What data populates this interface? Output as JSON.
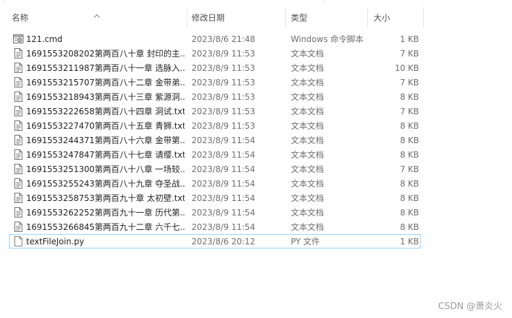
{
  "columns": {
    "name": "名称",
    "date": "修改日期",
    "type": "类型",
    "size": "大小"
  },
  "sort": {
    "column": "name",
    "icon": "chevron-up-icon"
  },
  "files": [
    {
      "name": "121.cmd",
      "date": "2023/8/6 21:48",
      "type": "Windows 命令脚本",
      "size": "1 KB",
      "icon": "cmd-file-icon"
    },
    {
      "name": "1691553208202第两百八十章 封印的主...",
      "date": "2023/8/9 11:53",
      "type": "文本文档",
      "size": "7 KB",
      "icon": "text-file-icon"
    },
    {
      "name": "1691553211987第两百八十一章 选脉入...",
      "date": "2023/8/9 11:53",
      "type": "文本文档",
      "size": "10 KB",
      "icon": "text-file-icon"
    },
    {
      "name": "1691553215707第两百八十二章 金带弟...",
      "date": "2023/8/9 11:53",
      "type": "文本文档",
      "size": "7 KB",
      "icon": "text-file-icon"
    },
    {
      "name": "1691553218943第两百八十三章 紫源洞...",
      "date": "2023/8/9 11:53",
      "type": "文本文档",
      "size": "8 KB",
      "icon": "text-file-icon"
    },
    {
      "name": "1691553222658第两百八十四章 洞试.txt",
      "date": "2023/8/9 11:53",
      "type": "文本文档",
      "size": "7 KB",
      "icon": "text-file-icon"
    },
    {
      "name": "1691553227470第两百八十五章 青狮.txt",
      "date": "2023/8/9 11:53",
      "type": "文本文档",
      "size": "8 KB",
      "icon": "text-file-icon"
    },
    {
      "name": "1691553244371第两百八十六章 金带第...",
      "date": "2023/8/9 11:54",
      "type": "文本文档",
      "size": "8 KB",
      "icon": "text-file-icon"
    },
    {
      "name": "1691553247847第两百八十七章 请缨.txt",
      "date": "2023/8/9 11:54",
      "type": "文本文档",
      "size": "8 KB",
      "icon": "text-file-icon"
    },
    {
      "name": "1691553251300第两百八十八章 一场较...",
      "date": "2023/8/9 11:54",
      "type": "文本文档",
      "size": "7 KB",
      "icon": "text-file-icon"
    },
    {
      "name": "1691553255243第两百八十九章 夺圣战...",
      "date": "2023/8/9 11:54",
      "type": "文本文档",
      "size": "8 KB",
      "icon": "text-file-icon"
    },
    {
      "name": "1691553258753第两百九十章 太初壁.txt",
      "date": "2023/8/9 11:54",
      "type": "文本文档",
      "size": "8 KB",
      "icon": "text-file-icon"
    },
    {
      "name": "1691553262252第两百九十一章 历代第...",
      "date": "2023/8/9 11:54",
      "type": "文本文档",
      "size": "8 KB",
      "icon": "text-file-icon"
    },
    {
      "name": "1691553266845第两百九十二章 六千七...",
      "date": "2023/8/9 11:54",
      "type": "文本文档",
      "size": "8 KB",
      "icon": "text-file-icon"
    },
    {
      "name": "textFileJoin.py",
      "date": "2023/8/6 20:12",
      "type": "PY 文件",
      "size": "1 KB",
      "icon": "python-file-icon",
      "selected": true
    }
  ],
  "watermark": "CSDN @萧炎火",
  "colors": {
    "selection_border": "#99d1ff",
    "header_text": "#4d4d4d",
    "meta_text": "#6d6d6d"
  }
}
